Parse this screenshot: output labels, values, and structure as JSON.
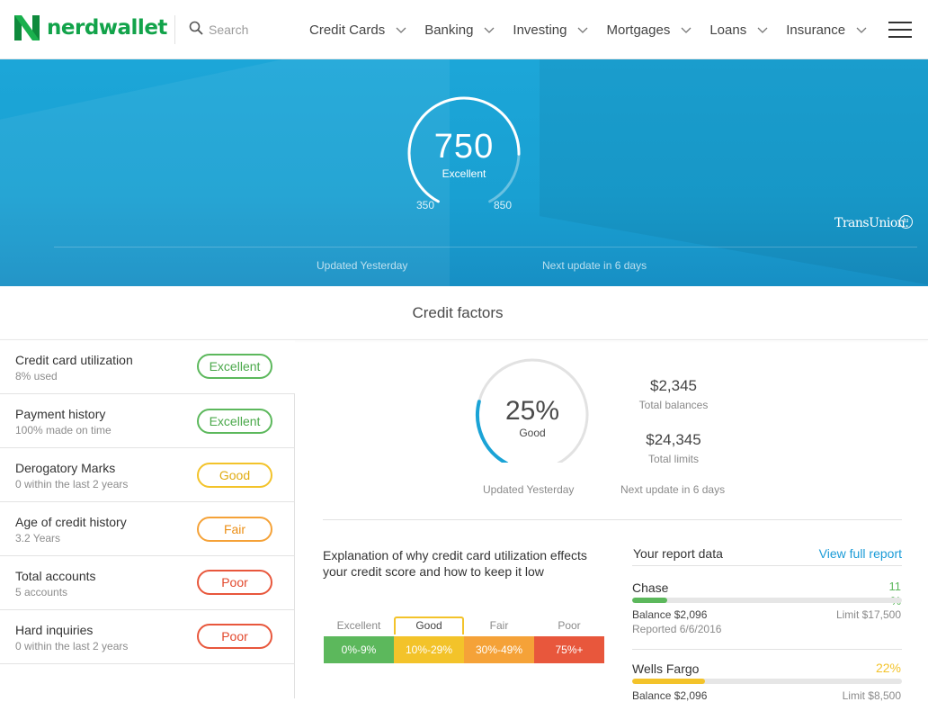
{
  "header": {
    "logo_text": "nerdwallet",
    "search_placeholder": "Search",
    "nav": [
      {
        "label": "Credit Cards"
      },
      {
        "label": "Banking"
      },
      {
        "label": "Investing"
      },
      {
        "label": "Mortgages"
      },
      {
        "label": "Loans"
      },
      {
        "label": "Insurance"
      }
    ]
  },
  "score": {
    "value": "750",
    "rating": "Excellent",
    "min": "350",
    "max": "850",
    "fill_fraction": 0.8,
    "updated": "Updated Yesterday",
    "next_update": "Next update in 6 days",
    "bureau": "TransUnion.",
    "bureau_badge": "tu"
  },
  "credit_factors_title": "Credit factors",
  "factors": [
    {
      "name": "Credit card utilization",
      "sub": "8% used",
      "rating": "Excellent",
      "color": "green"
    },
    {
      "name": "Payment history",
      "sub": "100% made on time",
      "rating": "Excellent",
      "color": "green"
    },
    {
      "name": "Derogatory Marks",
      "sub": "0 within the last 2 years",
      "rating": "Good",
      "color": "yellow"
    },
    {
      "name": "Age of credit history",
      "sub": "3.2 Years",
      "rating": "Fair",
      "color": "orange"
    },
    {
      "name": "Total accounts",
      "sub": "5 accounts",
      "rating": "Poor",
      "color": "red"
    },
    {
      "name": "Hard inquiries",
      "sub": "0 within the last 2 years",
      "rating": "Poor",
      "color": "red"
    }
  ],
  "utilization": {
    "percent": "25%",
    "rating": "Good",
    "fill_fraction": 0.25,
    "total_balances": "$2,345",
    "total_balances_label": "Total balances",
    "total_limits": "$24,345",
    "total_limits_label": "Total limits",
    "updated": "Updated Yesterday",
    "next_update": "Next update in 6 days",
    "explanation": "Explanation of why credit card utilization effects your credit score and how to keep it low",
    "scale": [
      {
        "label": "Excellent",
        "range": "0%-9%",
        "color": "#5cb85c"
      },
      {
        "label": "Good",
        "range": "10%-29%",
        "color": "#f3c32a"
      },
      {
        "label": "Fair",
        "range": "30%-49%",
        "color": "#f5a238"
      },
      {
        "label": "Poor",
        "range": "75%+",
        "color": "#e8573c"
      }
    ]
  },
  "report": {
    "title": "Your report data",
    "link": "View full report",
    "accounts": [
      {
        "name": "Chase",
        "pct_line1": "11",
        "pct_line2": "%",
        "fill": 0.13,
        "color": "#5cb85c",
        "balance": "Balance $2,096",
        "limit": "Limit $17,500",
        "reported": "Reported 6/6/2016"
      },
      {
        "name": "Wells Fargo",
        "pct_line1": "22%",
        "pct_line2": "",
        "fill": 0.27,
        "color": "#f3c32a",
        "balance": "Balance $2,096",
        "limit": "Limit $8,500",
        "reported": ""
      }
    ]
  }
}
